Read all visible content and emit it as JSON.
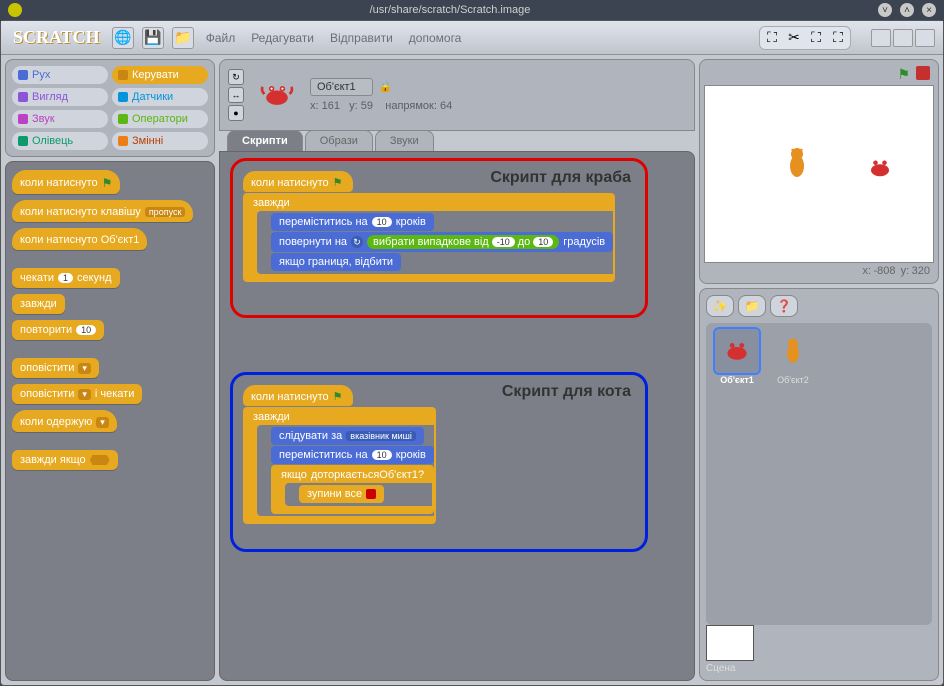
{
  "window": {
    "title": "/usr/share/scratch/Scratch.image"
  },
  "logo": "SCRATCH",
  "menu": {
    "file": "Файл",
    "edit": "Редагувати",
    "share": "Відправити",
    "help": "допомога"
  },
  "categories": {
    "motion": "Рух",
    "control": "Керувати",
    "looks": "Вигляд",
    "sensing": "Датчики",
    "sound": "Звук",
    "operators": "Оператори",
    "pen": "Олівець",
    "variables": "Змінні"
  },
  "palette": {
    "when_flag": "коли натиснуто",
    "when_key": "коли натиснуто клавішу",
    "when_key_arg": "пропуск",
    "when_clicked": "коли натиснуто Об'єкт1",
    "wait": "чекати",
    "wait_arg": "1",
    "wait_sec": "секунд",
    "forever": "завжди",
    "repeat": "повторити",
    "repeat_arg": "10",
    "broadcast": "оповістити",
    "broadcast_wait": "оповістити",
    "and_wait": "і чекати",
    "when_receive": "коли одержую",
    "forever_if": "завжди якщо"
  },
  "sprite": {
    "name": "Об'єкт1",
    "x_label": "x:",
    "x": "161",
    "y_label": "y:",
    "y": "59",
    "dir_label": "напрямок:",
    "dir": "64"
  },
  "tabs": {
    "scripts": "Скрипти",
    "costumes": "Образи",
    "sounds": "Звуки"
  },
  "script1": {
    "title": "Скрипт для краба",
    "hat": "коли натиснуто",
    "forever": "завжди",
    "move": "переміститись на",
    "move_n": "10",
    "steps": "кроків",
    "turn": "повернути на",
    "rand": "вибрати випадкове від",
    "rand_a": "-10",
    "rand_to": "до",
    "rand_b": "10",
    "degrees": "градусів",
    "bounce": "якщо границя, відбити"
  },
  "script2": {
    "title": "Скрипт для кота",
    "hat": "коли натиснуто",
    "forever": "завжди",
    "point": "слідувати за",
    "point_arg": "вказівник миші",
    "move": "переміститись на",
    "move_n": "10",
    "steps": "кроків",
    "if": "якщо",
    "touching": "доторкається",
    "touch_arg": "Об'єкт1",
    "stop": "зупини все"
  },
  "stage": {
    "coords_x_label": "x:",
    "coords_x": "-808",
    "coords_y_label": "y:",
    "coords_y": "320",
    "label": "Сцена"
  },
  "sprites": {
    "s1": "Об'єкт1",
    "s2": "Об'єкт2"
  }
}
